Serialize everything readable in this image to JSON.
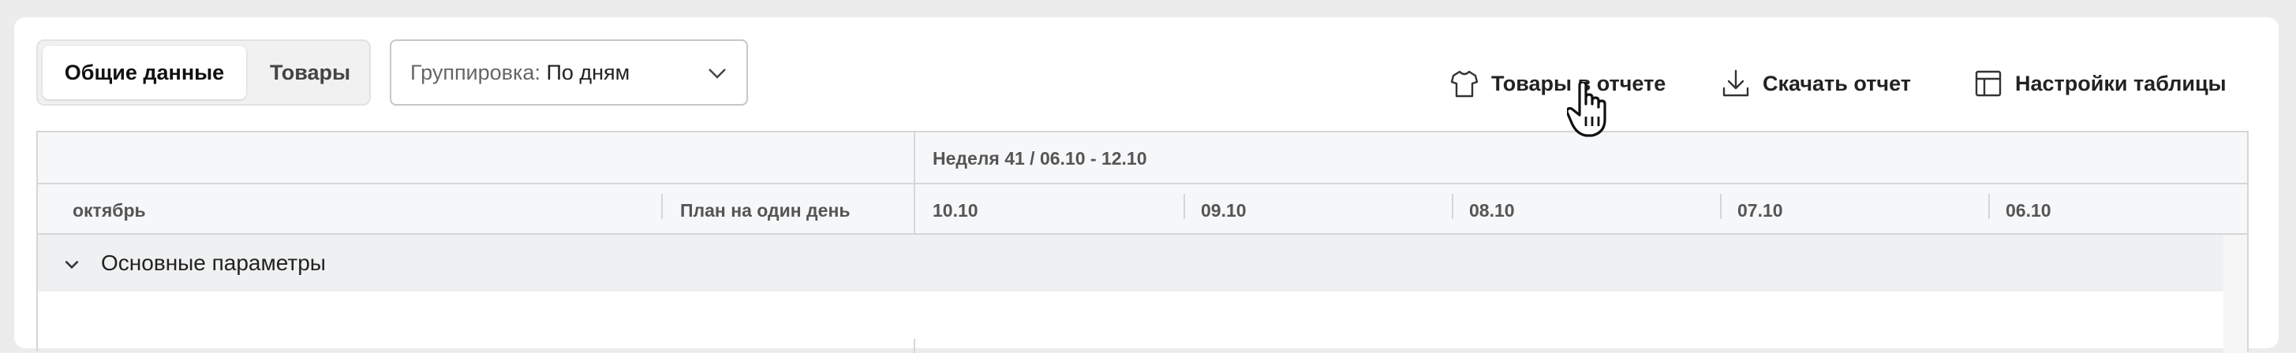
{
  "toolbar": {
    "tabs": [
      "Общие данные",
      "Товары"
    ],
    "grouping_label": "Группировка:",
    "grouping_value": "По дням",
    "actions": [
      {
        "label": "Товары в отчете",
        "icon": "tshirt-icon"
      },
      {
        "label": "Скачать отчет",
        "icon": "download-icon"
      },
      {
        "label": "Настройки таблицы",
        "icon": "table-settings-icon"
      }
    ]
  },
  "table": {
    "week_header": "Неделя 41 / 06.10 - 12.10",
    "month_col": "октябрь",
    "plan_col": "План на один день",
    "days": [
      "10.10",
      "09.10",
      "08.10",
      "07.10",
      "06.10"
    ],
    "group_row": "Основные параметры"
  }
}
